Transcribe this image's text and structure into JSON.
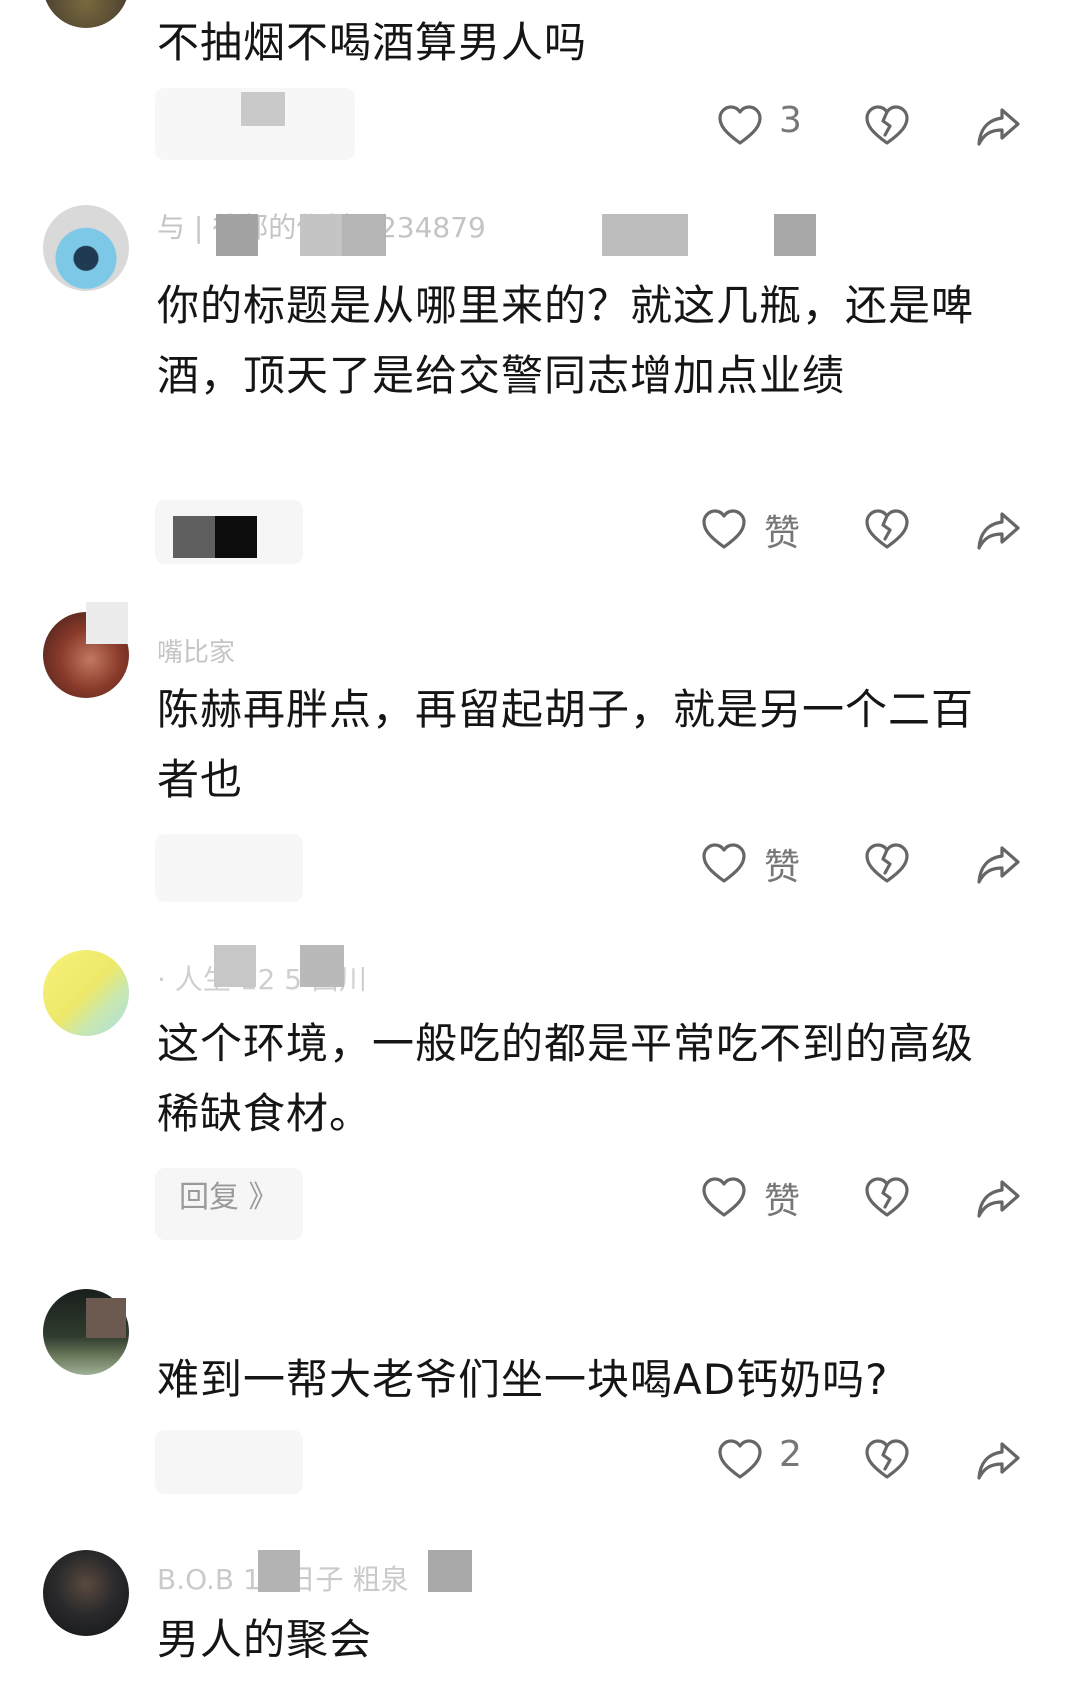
{
  "comments": [
    {
      "username": "",
      "text": "不抽烟不喝酒算男人吗",
      "reply_label": "",
      "like_text": "3",
      "avatar_color": "#5a5038"
    },
    {
      "username": "与 | 待邮的优材 8234879",
      "text": "你的标题是从哪里来的？就这几瓶，还是啤酒，顶天了是给交警同志增加点业绩",
      "reply_label": "",
      "like_text": "赞",
      "avatar_color": "#6fb6d6"
    },
    {
      "username": "嘴比家",
      "text": "陈赫再胖点，再留起胡子，就是另一个二百者也",
      "reply_label": "",
      "like_text": "赞",
      "avatar_color": "#8a4a3a"
    },
    {
      "username": "· 人生 12 5 西川",
      "text": "这个环境，一般吃的都是平常吃不到的高级稀缺食材。",
      "reply_label": "回复 》",
      "like_text": "赞",
      "avatar_color": "#f2ec78"
    },
    {
      "username": "",
      "text": "难到一帮大老爷们坐一块喝AD钙奶吗?",
      "reply_label": "",
      "like_text": "2",
      "avatar_color": "#2c3a2a"
    },
    {
      "username": "B.O.B 14 日子 粗泉",
      "text": "男人的聚会",
      "reply_label": "",
      "like_text": "",
      "avatar_color": "#1f2426"
    }
  ],
  "icons": {
    "like": "heart-outline-icon",
    "dislike": "broken-heart-icon",
    "share": "share-arrow-icon"
  }
}
